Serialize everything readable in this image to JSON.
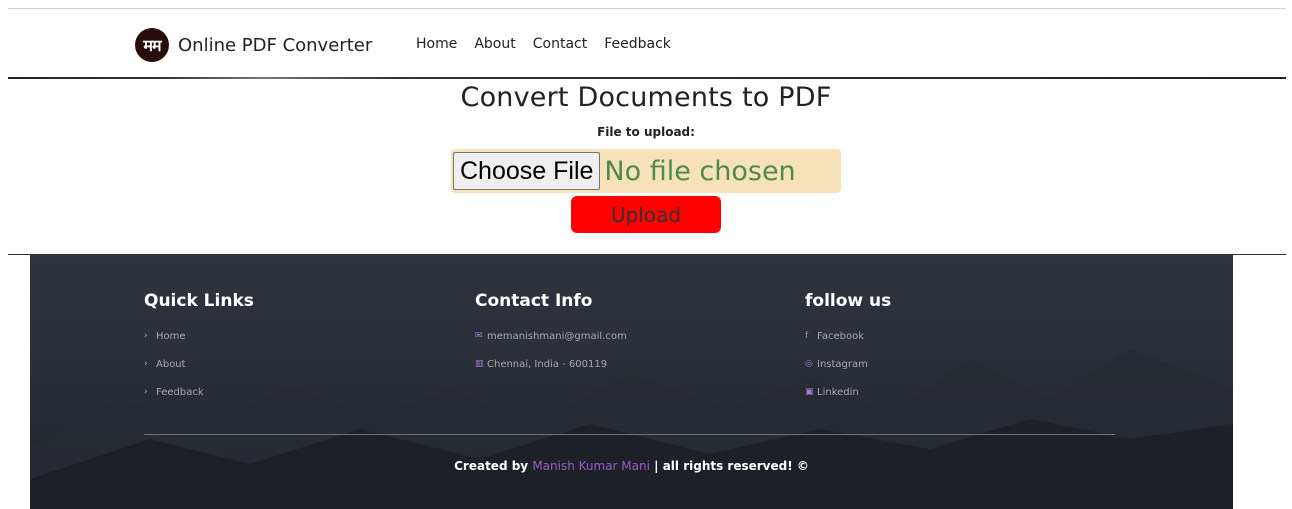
{
  "navbar": {
    "logo_text": "मम",
    "brand": "Online PDF Converter",
    "links": [
      "Home",
      "About",
      "Contact",
      "Feedback"
    ]
  },
  "main": {
    "title": "Convert Documents to PDF",
    "file_label": "File to upload:",
    "choose_file": "Choose File",
    "no_file": "No file chosen",
    "upload": "Upload"
  },
  "footer": {
    "quick_links": {
      "title": "Quick Links",
      "items": [
        "Home",
        "About",
        "Feedback"
      ]
    },
    "contact": {
      "title": "Contact Info",
      "email": "memanishmani@gmail.com",
      "location": "Chennai, India - 600119"
    },
    "follow": {
      "title": "follow us",
      "items": [
        "Facebook",
        "Instagram",
        "Linkedin"
      ]
    },
    "copyright": {
      "prefix": "Created by",
      "author": "Manish Kumar Mani",
      "suffix": "| all rights reserved! ©"
    }
  },
  "colors": {
    "upload_button": "#ff0000",
    "file_row_bg": "#f7e1b9",
    "no_file_text": "#4e8a4e",
    "footer_bg": "#2b2f38",
    "accent": "#9b59c9"
  }
}
